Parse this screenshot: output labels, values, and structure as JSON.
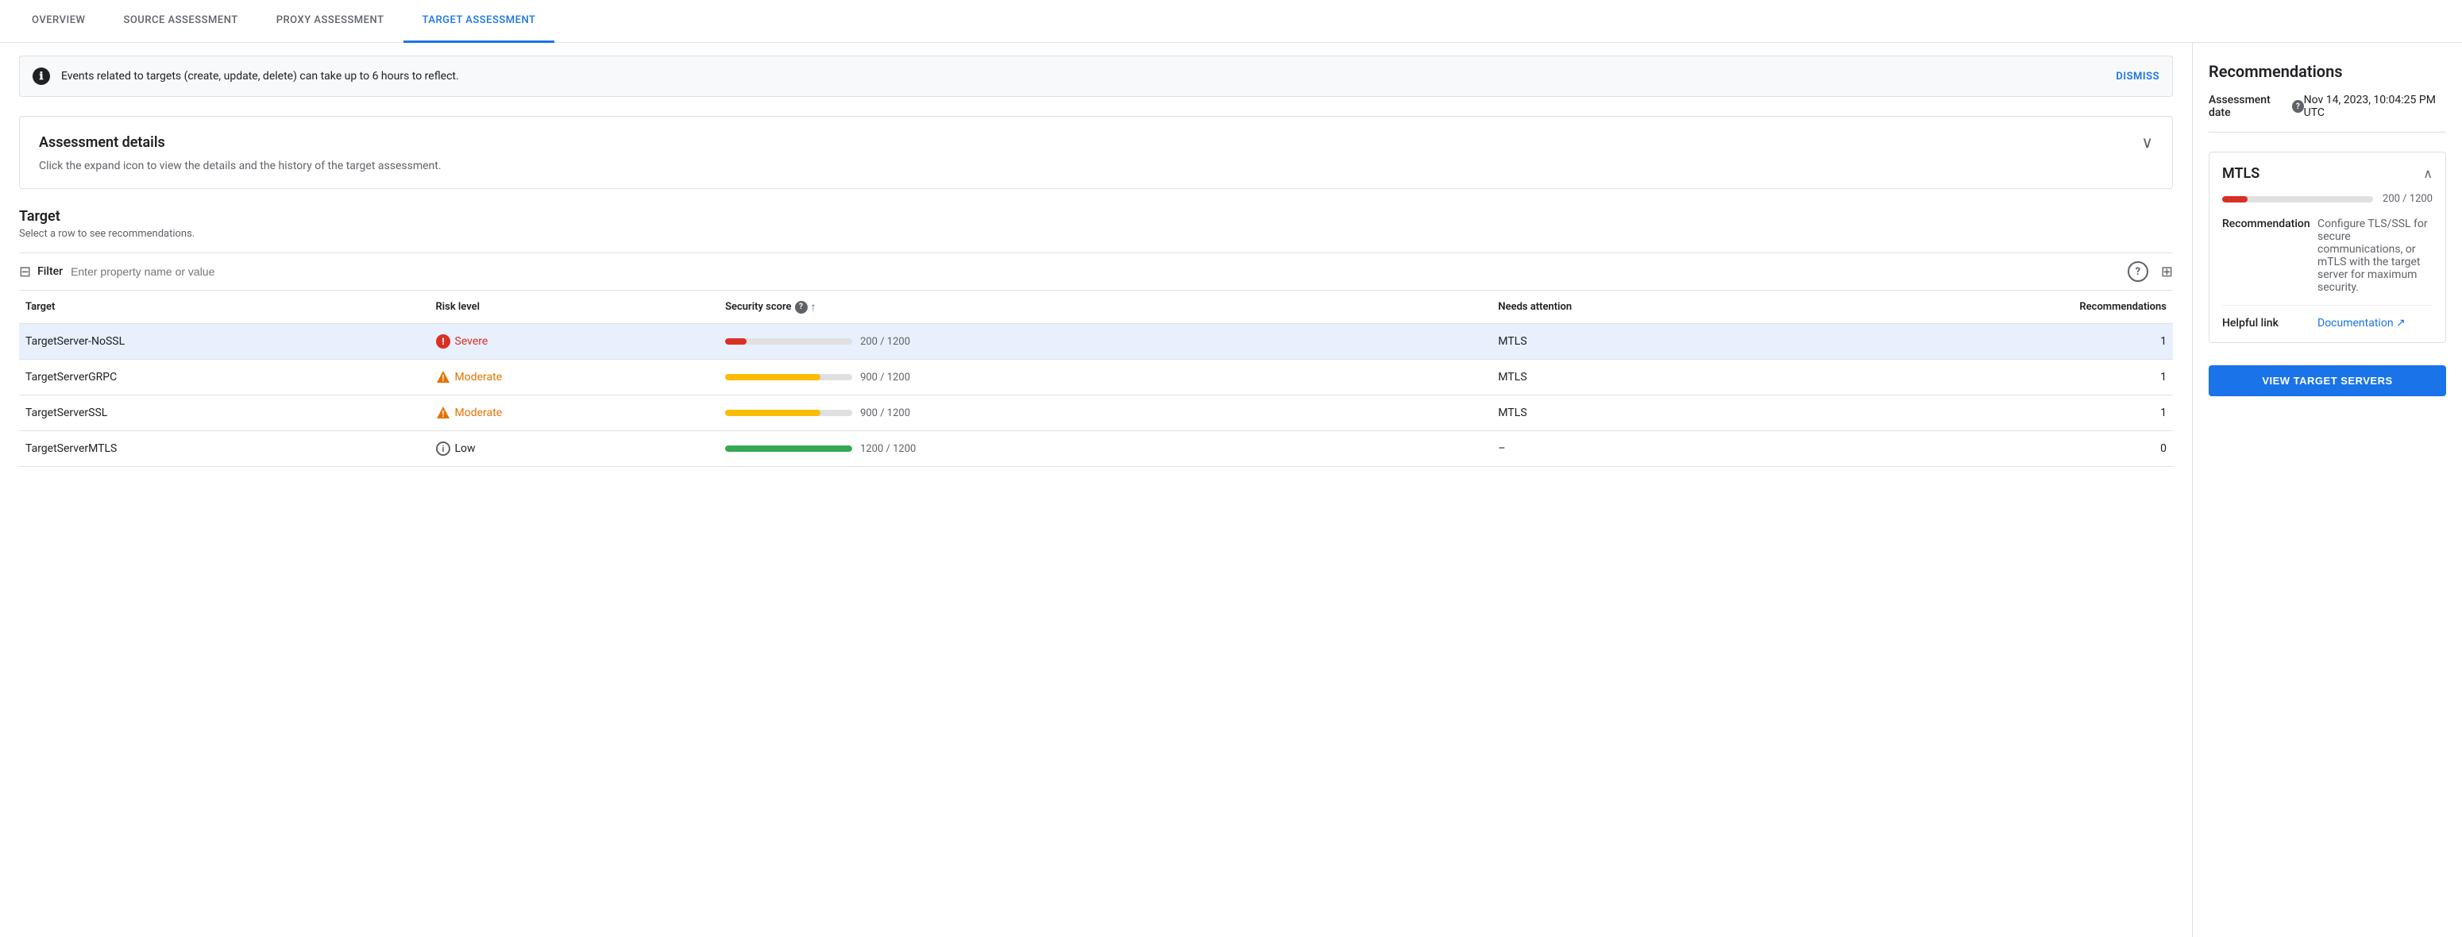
{
  "tabs": [
    {
      "id": "overview",
      "label": "OVERVIEW",
      "active": false
    },
    {
      "id": "source",
      "label": "SOURCE ASSESSMENT",
      "active": false
    },
    {
      "id": "proxy",
      "label": "PROXY ASSESSMENT",
      "active": false
    },
    {
      "id": "target",
      "label": "TARGET ASSESSMENT",
      "active": true
    }
  ],
  "banner": {
    "text": "Events related to targets (create, update, delete) can take up to 6 hours to reflect.",
    "dismiss_label": "DISMISS"
  },
  "assessment_details": {
    "title": "Assessment details",
    "description": "Click the expand icon to view the details and the history of the target assessment."
  },
  "target_section": {
    "title": "Target",
    "subtitle": "Select a row to see recommendations.",
    "filter_placeholder": "Enter property name or value",
    "filter_label": "Filter",
    "columns": {
      "target": "Target",
      "risk_level": "Risk level",
      "security_score": "Security score",
      "needs_attention": "Needs attention",
      "recommendations": "Recommendations"
    },
    "rows": [
      {
        "id": "row-1",
        "target": "TargetServer-NoSSL",
        "risk_level": "Severe",
        "risk_type": "severe",
        "score_value": "200 / 1200",
        "score_pct": 16.67,
        "needs_attention": "MTLS",
        "recommendations": "1",
        "selected": true
      },
      {
        "id": "row-2",
        "target": "TargetServerGRPC",
        "risk_level": "Moderate",
        "risk_type": "moderate",
        "score_value": "900 / 1200",
        "score_pct": 75,
        "needs_attention": "MTLS",
        "recommendations": "1",
        "selected": false
      },
      {
        "id": "row-3",
        "target": "TargetServerSSL",
        "risk_level": "Moderate",
        "risk_type": "moderate",
        "score_value": "900 / 1200",
        "score_pct": 75,
        "needs_attention": "MTLS",
        "recommendations": "1",
        "selected": false
      },
      {
        "id": "row-4",
        "target": "TargetServerMTLS",
        "risk_level": "Low",
        "risk_type": "low",
        "score_value": "1200 / 1200",
        "score_pct": 100,
        "needs_attention": "–",
        "recommendations": "0",
        "selected": false
      }
    ]
  },
  "right_panel": {
    "title": "Recommendations",
    "assessment_date_label": "Assessment date",
    "assessment_date_value": "Nov 14, 2023, 10:04:25 PM UTC",
    "mtls": {
      "title": "MTLS",
      "score_value": "200 / 1200",
      "score_pct": 16.67,
      "recommendation_label": "Recommendation",
      "recommendation_value": "Configure TLS/SSL for secure communications, or mTLS with the target server for maximum security.",
      "helpful_link_label": "Helpful link",
      "helpful_link_text": "Documentation ↗",
      "helpful_link_href": "#"
    },
    "view_servers_label": "VIEW TARGET SERVERS"
  },
  "icons": {
    "info_circle": "ℹ",
    "chevron_down": "∨",
    "chevron_up": "∧",
    "severe_icon": "🔴",
    "moderate_icon": "⚠",
    "low_icon": "ℹ",
    "filter_lines": "≡",
    "sort_up": "↑",
    "columns_icon": "⊞",
    "external_link": "↗"
  }
}
